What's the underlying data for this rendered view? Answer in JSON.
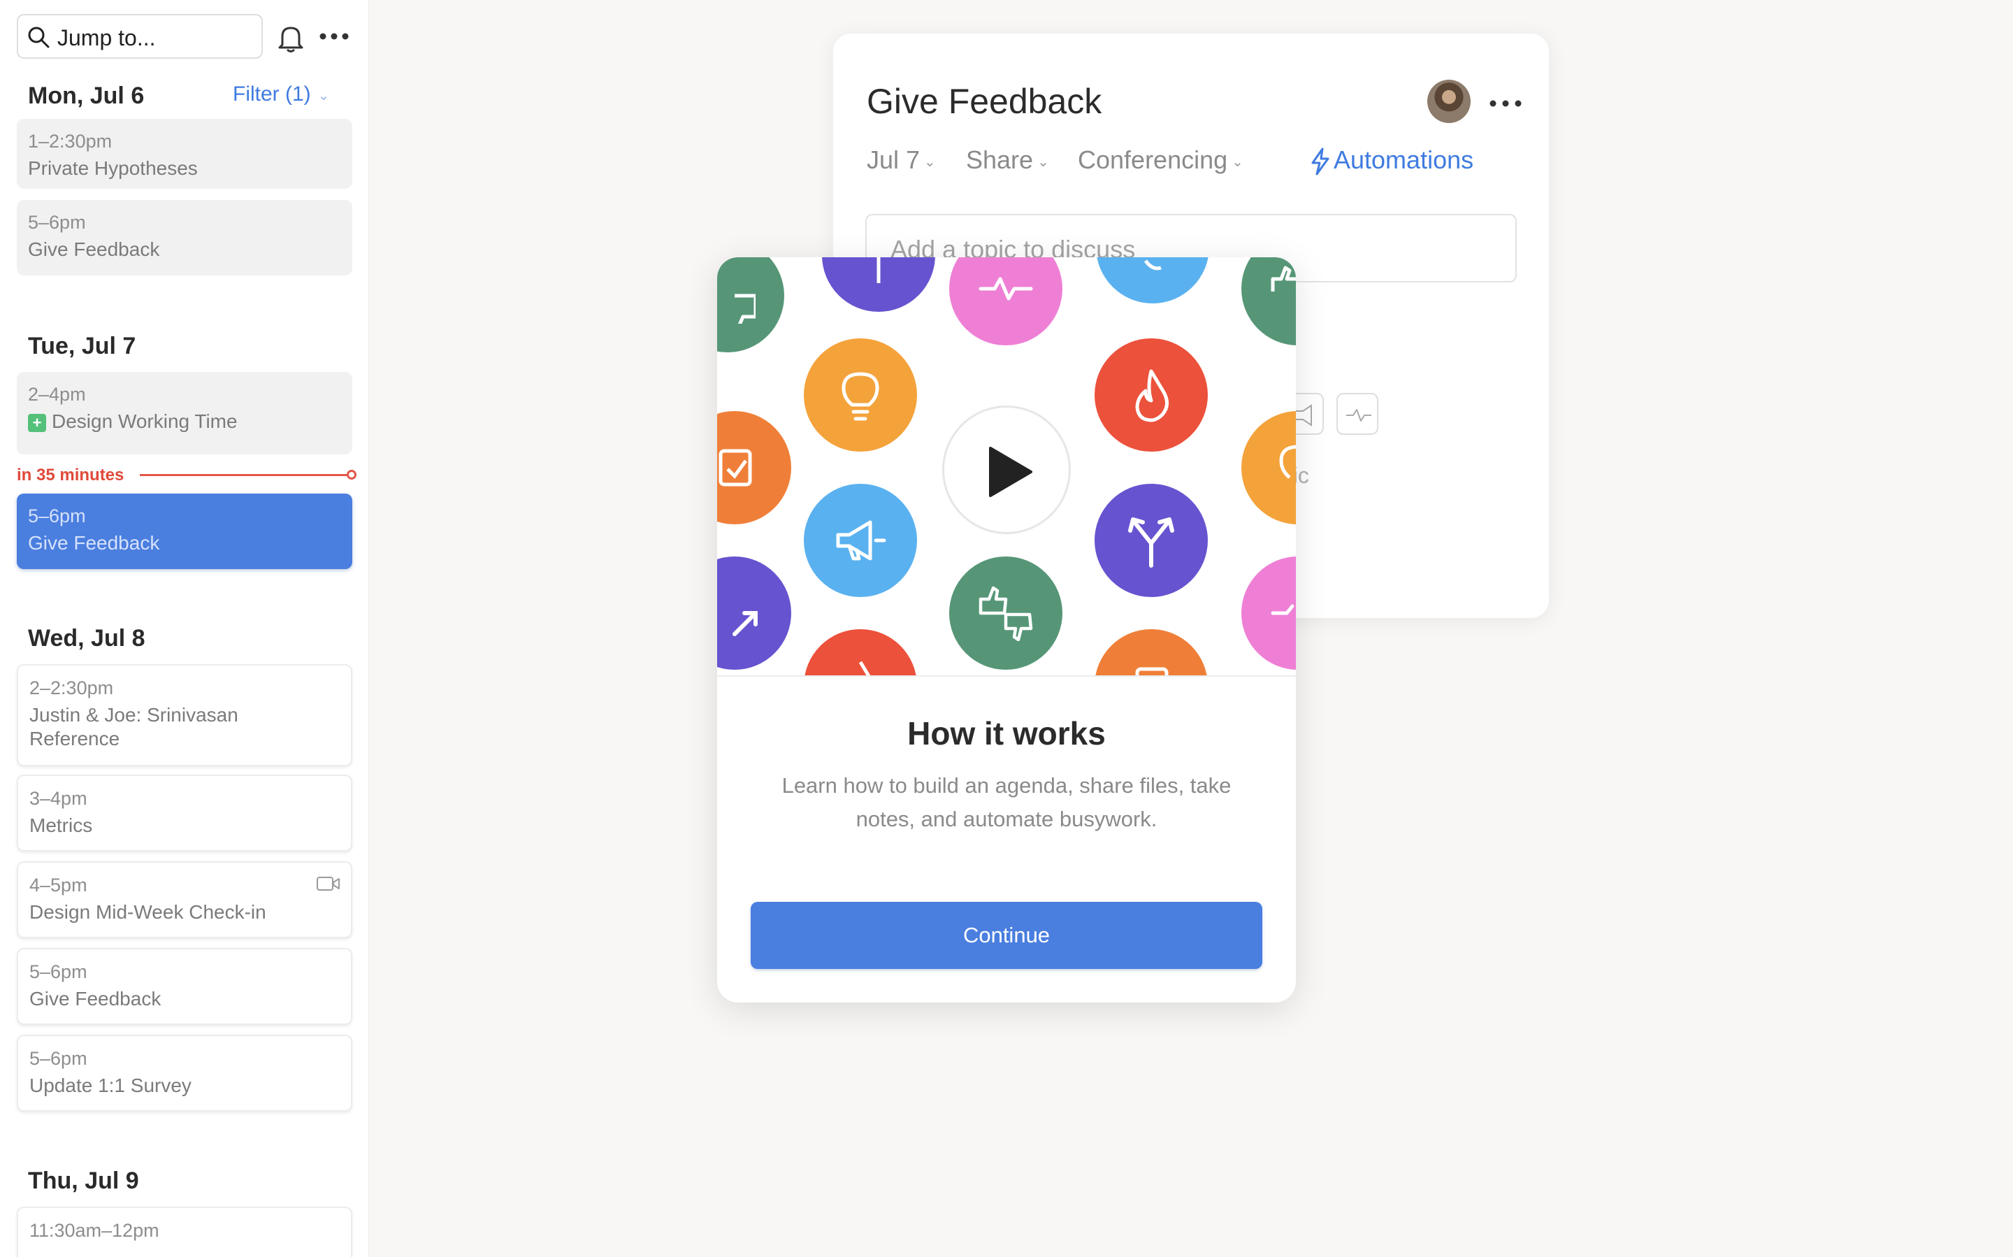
{
  "search": {
    "placeholder": "Jump to..."
  },
  "filter": {
    "label": "Filter (1)"
  },
  "now_indicator": {
    "label": "in 35 minutes"
  },
  "days": [
    {
      "header": "Mon, Jul 6",
      "events": [
        {
          "time": "1–2:30pm",
          "title": "Private Hypotheses"
        },
        {
          "time": "5–6pm",
          "title": "Give Feedback"
        }
      ]
    },
    {
      "header": "Tue, Jul 7",
      "events": [
        {
          "time": "2–4pm",
          "title": "Design Working Time"
        },
        {
          "time": "5–6pm",
          "title": "Give Feedback"
        }
      ]
    },
    {
      "header": "Wed, Jul 8",
      "events": [
        {
          "time": "2–2:30pm",
          "title": "Justin & Joe: Srinivasan Reference"
        },
        {
          "time": "3–4pm",
          "title": "Metrics"
        },
        {
          "time": "4–5pm",
          "title": "Design Mid-Week Check-in"
        },
        {
          "time": "5–6pm",
          "title": "Give Feedback"
        },
        {
          "time": "5–6pm",
          "title": "Update 1:1 Survey"
        }
      ]
    },
    {
      "header": "Thu, Jul 9",
      "events": [
        {
          "time": "11:30am–12pm",
          "title": ""
        }
      ]
    }
  ],
  "meeting": {
    "title": "Give Feedback",
    "toolbar": {
      "date": "Jul 7",
      "share": "Share",
      "conferencing": "Conferencing",
      "automations": "Automations"
    },
    "topic_placeholder": "Add a topic to discuss",
    "fragment_text": "pic"
  },
  "modal": {
    "title": "How it works",
    "description": "Learn how to build an agenda, share files, take notes, and automate busywork.",
    "continue_label": "Continue"
  },
  "colors": {
    "accent": "#4a7edf",
    "link": "#3f7be0",
    "now": "#e2574a",
    "purple": "#6653d0",
    "pink": "#ee7fd5",
    "sky": "#5ab1ef",
    "green": "#569677",
    "orange": "#ef7f38",
    "amber": "#f4a23a",
    "red": "#ec513b"
  }
}
